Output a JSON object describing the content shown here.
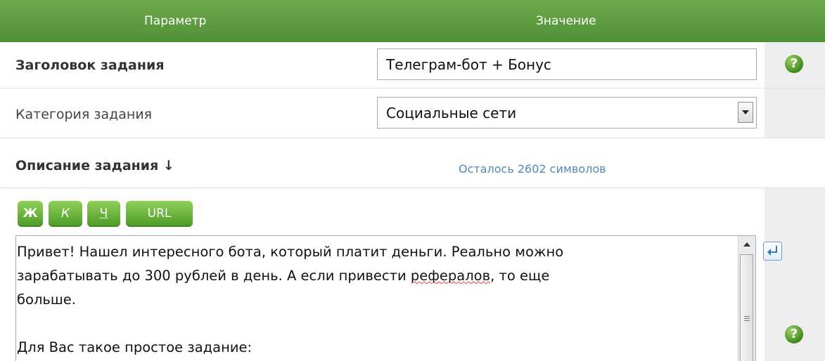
{
  "header": {
    "param_label": "Параметр",
    "value_label": "Значение"
  },
  "title_row": {
    "label": "Заголовок задания",
    "value": "Телеграм-бот + Бонус"
  },
  "category_row": {
    "label": "Категория задания",
    "selected": "Социальные сети"
  },
  "description_row": {
    "label": "Описание задания ↓",
    "remaining": "Осталось 2602 символов",
    "format_buttons": {
      "bold": "Ж",
      "italic": "К",
      "underline": "Ч",
      "url": "URL"
    },
    "text_lines": {
      "line1": "Привет! Нашел интересного бота, который платит деньги. Реально можно",
      "line2_pre": "зарабатывать до 300 рублей в день. А если привести ",
      "line2_spell": "рефералов",
      "line2_post": ", то еще",
      "line3": "больше.",
      "line4": "",
      "line5": "Для Вас такое простое задание:"
    }
  },
  "help_icon": "?",
  "colors": {
    "header_green": "#5b9b3f",
    "button_green": "#5fae34",
    "link_blue": "#4f88b8",
    "side_gray": "#eeeeee"
  },
  "icons": [
    "help-icon",
    "chevron-down-icon",
    "scroll-up-arrow-icon",
    "return-arrow-icon"
  ]
}
